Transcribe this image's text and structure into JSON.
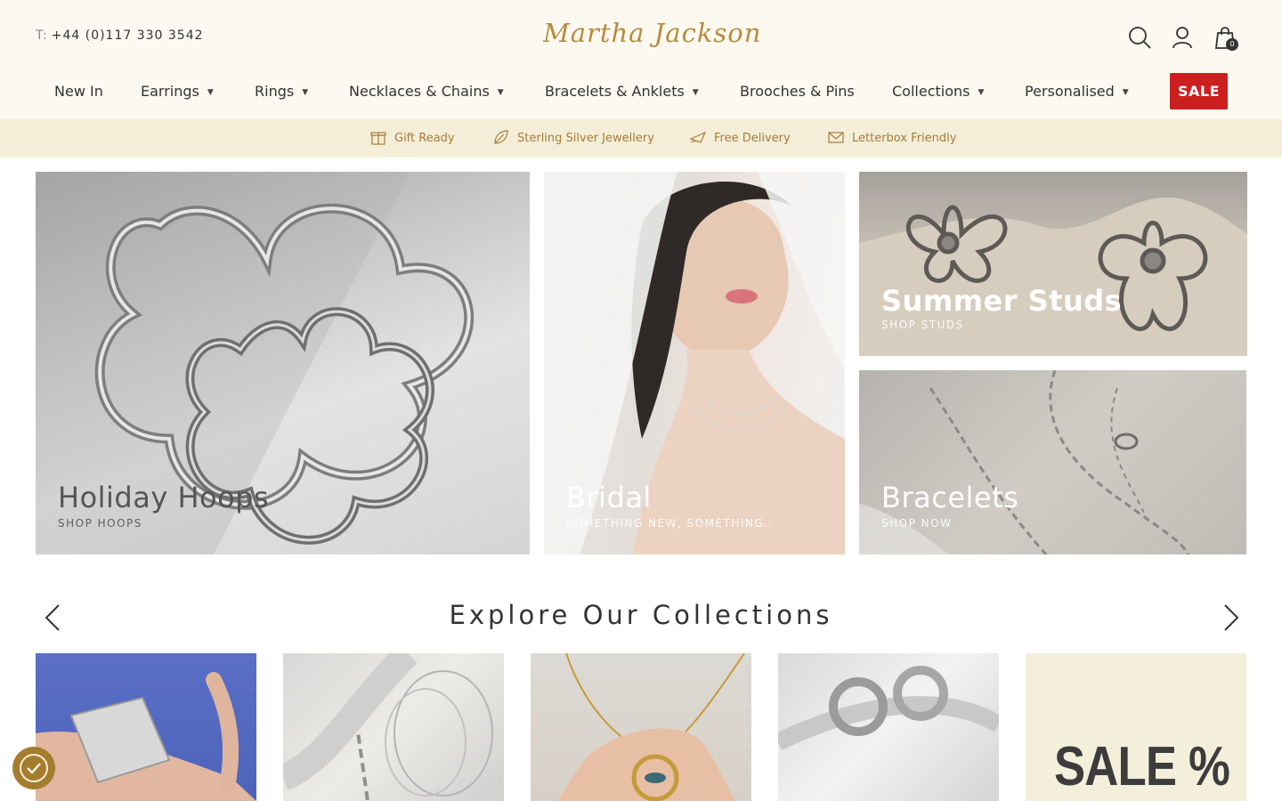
{
  "header": {
    "phone_label": "T:",
    "phone": "+44 (0)117 330 3542",
    "logo": "Martha Jackson",
    "icons": [
      "search-icon",
      "account-icon",
      "cart-icon"
    ],
    "cart_count": "0"
  },
  "nav": {
    "items": [
      {
        "label": "New In",
        "dropdown": false
      },
      {
        "label": "Earrings",
        "dropdown": true
      },
      {
        "label": "Rings",
        "dropdown": true
      },
      {
        "label": "Necklaces & Chains",
        "dropdown": true
      },
      {
        "label": "Bracelets & Anklets",
        "dropdown": true
      },
      {
        "label": "Brooches & Pins",
        "dropdown": false
      },
      {
        "label": "Collections",
        "dropdown": true
      },
      {
        "label": "Personalised",
        "dropdown": true
      }
    ],
    "caret": "▼",
    "sale_label": "SALE",
    "sale_color": "#cc1f1f"
  },
  "usp": {
    "items": [
      {
        "icon": "gift-icon",
        "label": "Gift Ready"
      },
      {
        "icon": "leaf-icon",
        "label": "Sterling Silver Jewellery"
      },
      {
        "icon": "delivery-icon",
        "label": "Free Delivery"
      },
      {
        "icon": "envelope-icon",
        "label": "Letterbox Friendly"
      }
    ],
    "text_color": "#a57c3a",
    "background": "#f4eed8"
  },
  "hero": [
    {
      "title": "Holiday Hoops",
      "subtitle": "SHOP HOOPS"
    },
    {
      "title": "Bridal",
      "subtitle": "SOMETHING NEW, SOMETHING.."
    },
    {
      "title": "Summer Studs",
      "subtitle": "SHOP STUDS"
    },
    {
      "title": "Bracelets",
      "subtitle": "SHOP NOW"
    }
  ],
  "collections": {
    "title": "Explore Our Collections",
    "sale_tile_text": "SALE %"
  },
  "colors": {
    "header_bg": "#fbf9f0",
    "brand_gold": "#b78a3e",
    "accessibility_button": "#a57c2e"
  }
}
